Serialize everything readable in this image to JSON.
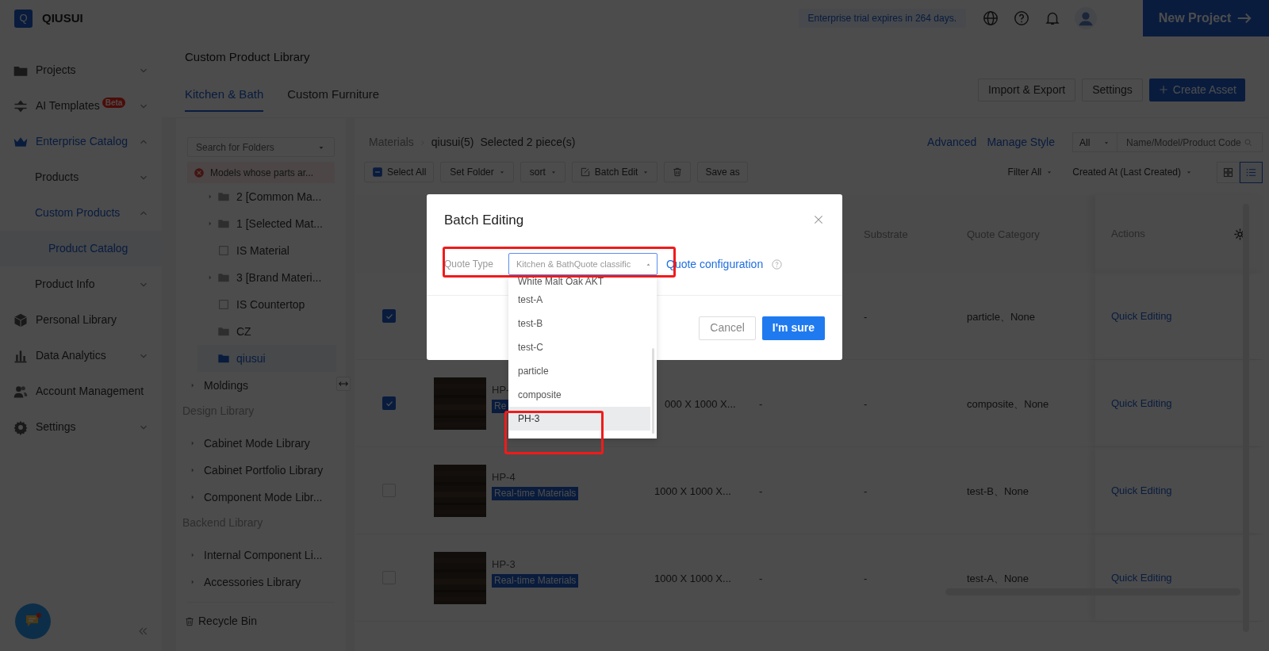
{
  "topbar": {
    "logo_letter": "Q",
    "brand": "QIUSUI",
    "trial_notice": "Enterprise trial expires in 264 days.",
    "new_project": "New Project"
  },
  "sidebar": {
    "items": [
      {
        "label": "Projects",
        "expanded": false,
        "selected": false
      },
      {
        "label": "AI Templates",
        "badge": "Beta",
        "expanded": false,
        "selected": false
      },
      {
        "label": "Enterprise Catalog",
        "expanded": true,
        "selected": false,
        "children": [
          {
            "label": "Products",
            "expanded": false,
            "selected": false
          },
          {
            "label": "Custom Products",
            "expanded": true,
            "selected": false,
            "children": [
              {
                "label": "Product Catalog",
                "selected": true
              }
            ]
          },
          {
            "label": "Product Info",
            "expanded": false,
            "selected": false
          }
        ]
      },
      {
        "label": "Personal Library",
        "selected": false
      },
      {
        "label": "Data Analytics",
        "expanded": false,
        "selected": false
      },
      {
        "label": "Account Management",
        "selected": false
      },
      {
        "label": "Settings",
        "expanded": false,
        "selected": false
      }
    ]
  },
  "page": {
    "title": "Custom Product Library",
    "tabs": [
      {
        "label": "Kitchen & Bath",
        "selected": true
      },
      {
        "label": "Custom Furniture",
        "selected": false
      }
    ],
    "actions": [
      {
        "label": "Import & Export",
        "kind": "plain"
      },
      {
        "label": "Settings",
        "kind": "plain"
      },
      {
        "label": "Create Asset",
        "kind": "primary"
      }
    ]
  },
  "folders": {
    "search_placeholder": "Search for Folders",
    "error_item": "Models whose parts ar...",
    "tree": [
      {
        "label": "2 [Common Ma...",
        "kind": "folder",
        "expandable": true,
        "selected": false
      },
      {
        "label": "1 [Selected Mat...",
        "kind": "folder",
        "expandable": true,
        "selected": false
      },
      {
        "label": "IS Material",
        "kind": "file",
        "expandable": false,
        "selected": false
      },
      {
        "label": "3 [Brand Materi...",
        "kind": "folder",
        "expandable": true,
        "selected": false
      },
      {
        "label": "IS Countertop",
        "kind": "file",
        "expandable": false,
        "selected": false
      },
      {
        "label": "CZ",
        "kind": "folder",
        "expandable": false,
        "selected": false
      },
      {
        "label": "qiusui",
        "kind": "folder",
        "expandable": false,
        "selected": true
      }
    ],
    "sections": [
      {
        "kind": "item",
        "label": "Moldings"
      },
      {
        "kind": "heading",
        "label": "Design Library"
      },
      {
        "kind": "item",
        "label": "Cabinet Mode Library"
      },
      {
        "kind": "item",
        "label": "Cabinet Portfolio Library"
      },
      {
        "kind": "item",
        "label": "Component Mode Libr..."
      },
      {
        "kind": "heading",
        "label": "Backend Library"
      },
      {
        "kind": "item",
        "label": "Internal Component Li..."
      },
      {
        "kind": "item",
        "label": "Accessories Library"
      }
    ],
    "recycle_bin": "Recycle Bin"
  },
  "content": {
    "breadcrumb": [
      "Materials",
      "qiusui(5)"
    ],
    "selection_note": "Selected 2 piece(s)",
    "toolbar": [
      {
        "label": "Select All",
        "kind": "select-all"
      },
      {
        "label": "Set Folder",
        "kind": "dropdown"
      },
      {
        "label": "sort",
        "kind": "dropdown"
      },
      {
        "label": "Batch Edit",
        "kind": "edit"
      },
      {
        "kind": "delete"
      },
      {
        "label": "Save as",
        "kind": "plain"
      }
    ],
    "links": [
      "Advanced",
      "Manage Style"
    ],
    "scope": "All",
    "search_placeholder": "Name/Model/Product Code",
    "filter": "Filter All",
    "order": "Created At (Last Created)",
    "views": [
      {
        "kind": "grid",
        "selected": false
      },
      {
        "kind": "list",
        "selected": true
      }
    ]
  },
  "table": {
    "columns": [
      "Substrate",
      "Quote Category",
      "Actions"
    ],
    "rows": [
      {
        "checked": true,
        "substrate": "-",
        "quote_category": "particle、None",
        "action": "Quick Editing"
      },
      {
        "checked": true,
        "name": "HP-",
        "tag": "Re",
        "size": "000 X 1000 X...",
        "column_4": "-",
        "substrate": "-",
        "quote_category": "composite、None",
        "action": "Quick Editing"
      },
      {
        "checked": false,
        "name": "HP-4",
        "tag": "Real-time Materials",
        "size": "1000 X 1000 X...",
        "column_4": "-",
        "substrate": "-",
        "quote_category": "test-B、None",
        "action": "Quick Editing"
      },
      {
        "checked": false,
        "name": "HP-3",
        "tag": "Real-time Materials",
        "size": "1000 X 1000 X...",
        "column_4": "-",
        "substrate": "-",
        "quote_category": "test-A、None",
        "action": "Quick Editing"
      }
    ]
  },
  "dialog": {
    "title": "Batch Editing",
    "field_label": "Quote Type",
    "placeholder": "Kitchen & BathQuote classific",
    "link": "Quote configuration",
    "buttons": [
      {
        "label": "Cancel",
        "kind": "plain"
      },
      {
        "label": "I'm sure",
        "kind": "primary"
      }
    ],
    "options": [
      {
        "label": "White Malt Oak AKT",
        "selected": false
      },
      {
        "label": "test-A",
        "selected": false
      },
      {
        "label": "test-B",
        "selected": false
      },
      {
        "label": "test-C",
        "selected": false
      },
      {
        "label": "particle",
        "selected": false
      },
      {
        "label": "composite",
        "selected": false
      },
      {
        "label": "PH-3",
        "selected": true
      }
    ]
  }
}
